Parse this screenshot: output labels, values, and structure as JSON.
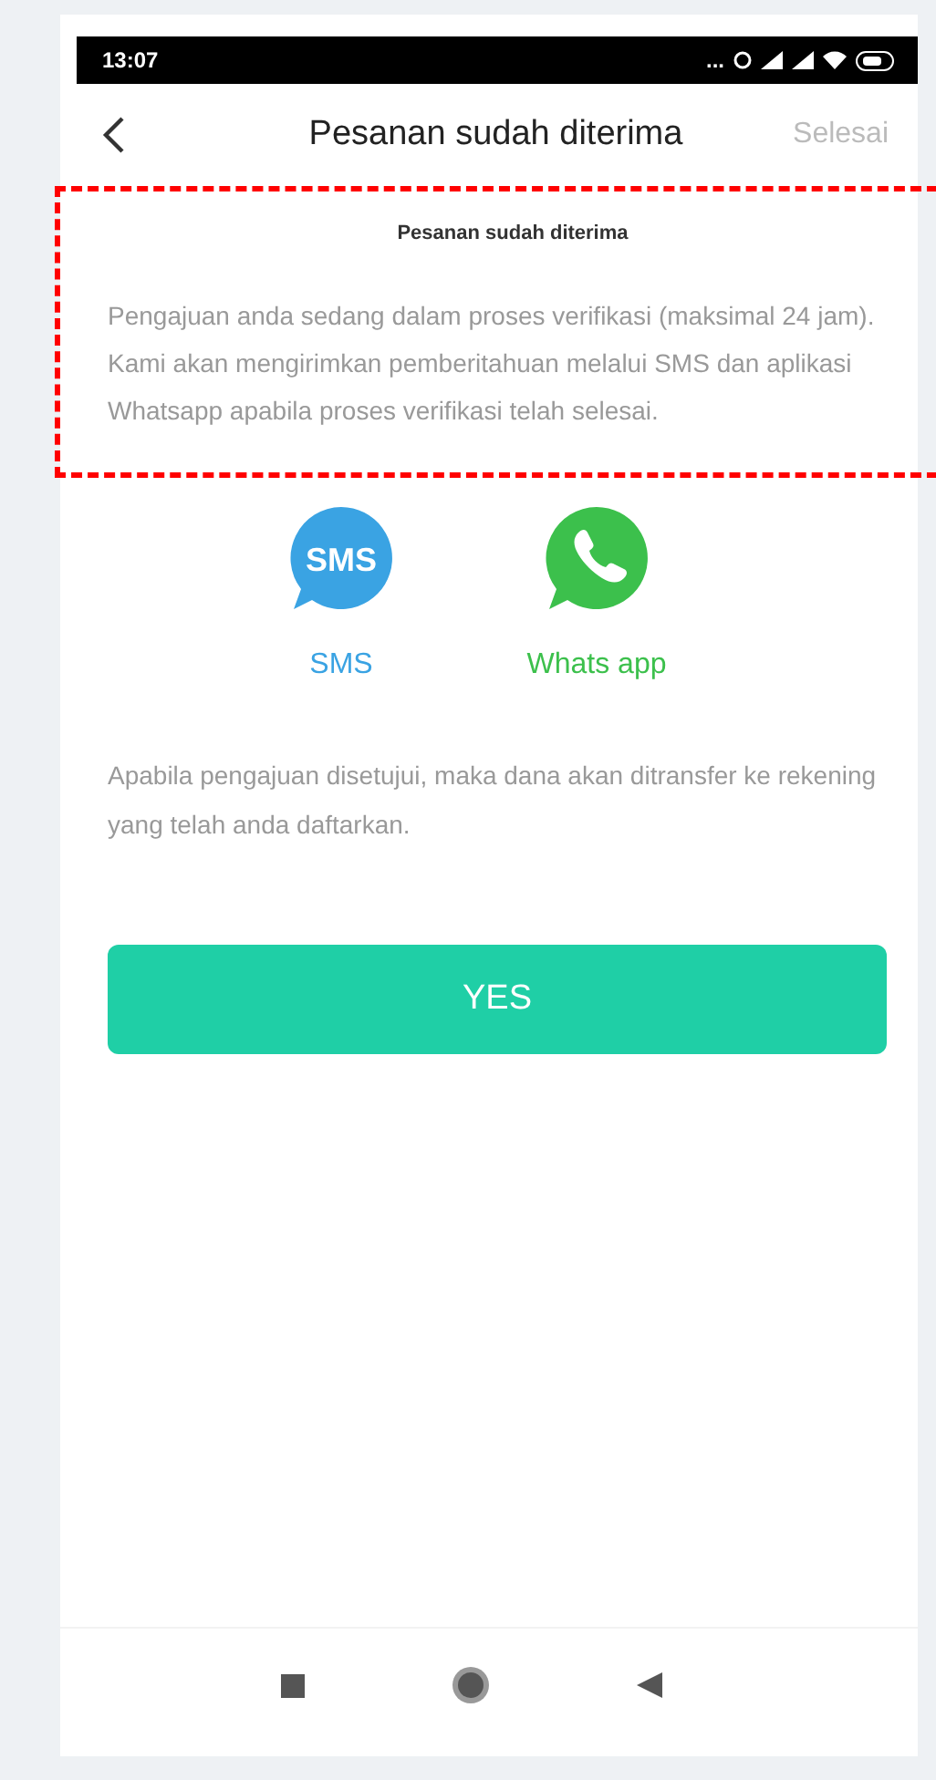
{
  "status_bar": {
    "time": "13:07",
    "overflow": "..."
  },
  "header": {
    "title": "Pesanan sudah diterima",
    "action": "Selesai"
  },
  "notice": {
    "title": "Pesanan sudah diterima",
    "text": "Pengajuan anda sedang dalam proses verifikasi (maksimal 24 jam). Kami akan mengirimkan pemberitahuan melalui SMS dan aplikasi Whatsapp apabila proses verifikasi telah selesai."
  },
  "channels": [
    {
      "kind": "sms",
      "label": "SMS",
      "badge": "SMS",
      "color": "#3aa3e3"
    },
    {
      "kind": "whatsapp",
      "label": "Whats app",
      "color": "#3cc04c"
    }
  ],
  "info": "Apabila pengajuan disetujui, maka dana akan ditransfer ke rekening yang telah anda daftarkan.",
  "button": "YES"
}
